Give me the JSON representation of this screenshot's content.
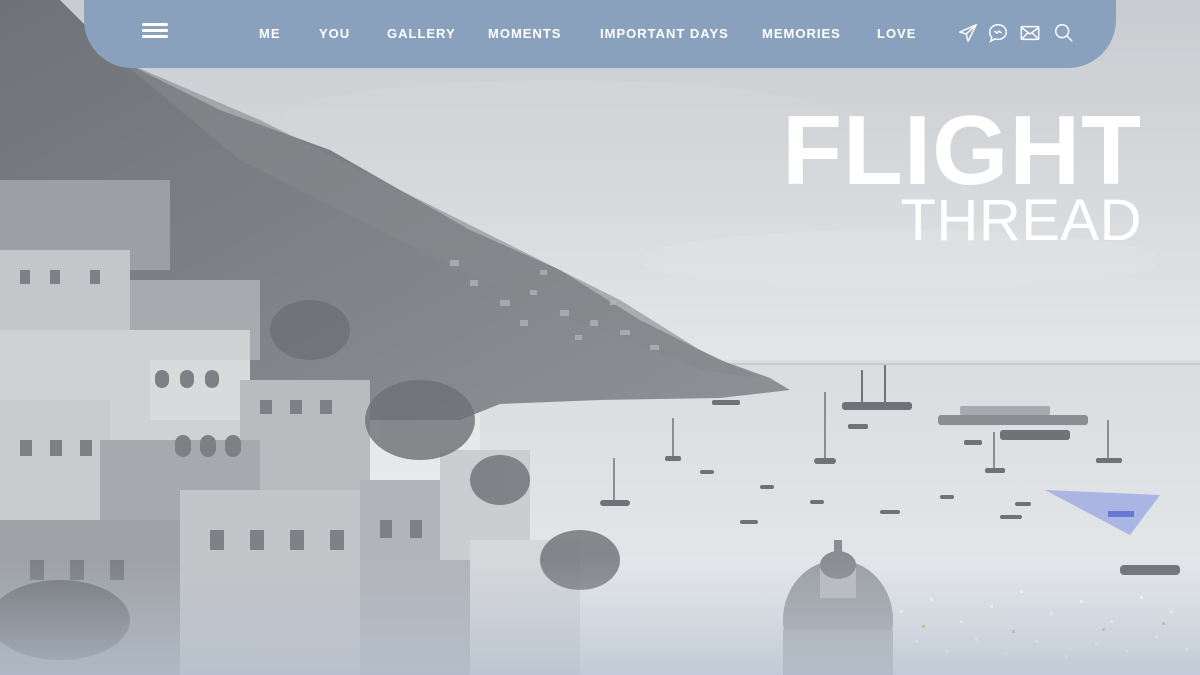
{
  "nav": {
    "links": [
      {
        "label": "ME"
      },
      {
        "label": "YOU"
      },
      {
        "label": "GALLERY"
      },
      {
        "label": "MOMENTS"
      },
      {
        "label": "IMPORTANT DAYS"
      },
      {
        "label": "MEMORIES"
      },
      {
        "label": "LOVE"
      }
    ],
    "icons": [
      "send-icon",
      "chat-icon",
      "mail-icon",
      "search-icon"
    ]
  },
  "hero": {
    "title": "FLIGHT",
    "subtitle": "THREAD"
  },
  "colors": {
    "navbar": "#8aa1bd",
    "title": "#ffffff"
  }
}
